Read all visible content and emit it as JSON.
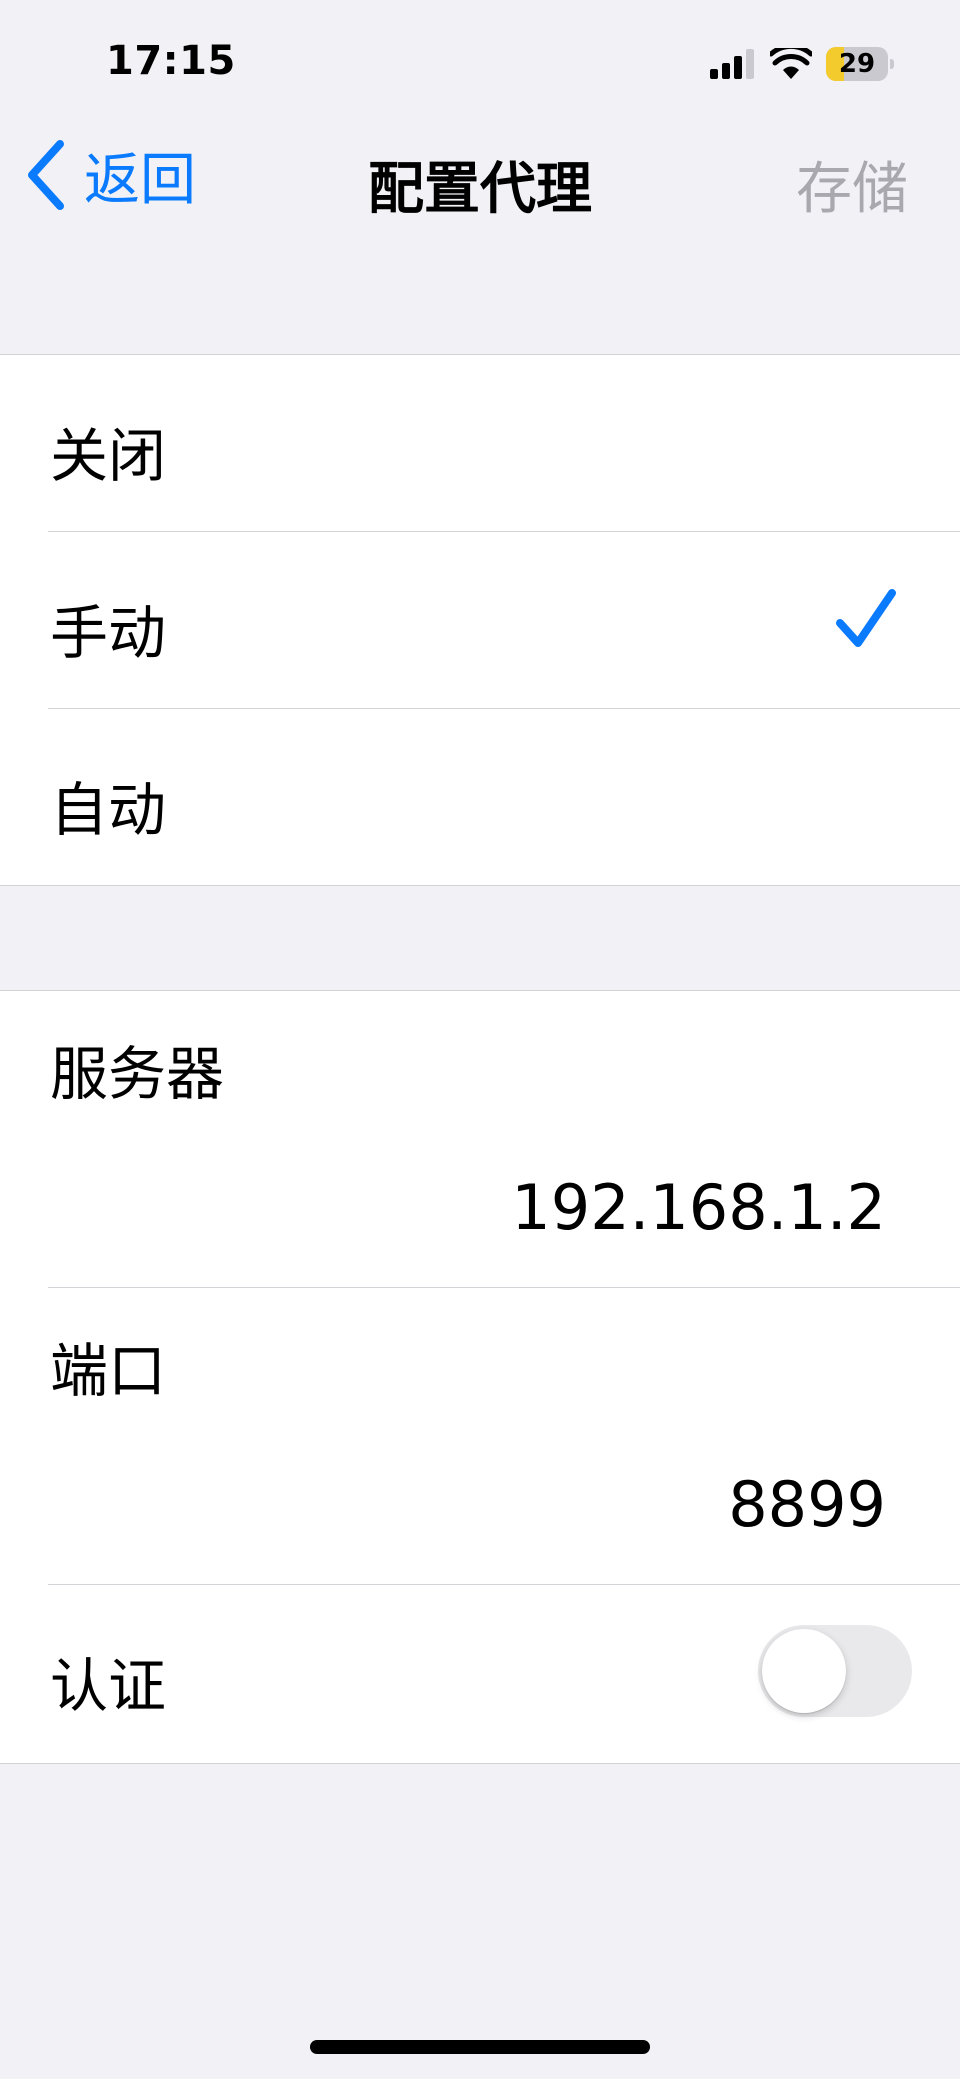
{
  "status_bar": {
    "time": "17:15",
    "battery_level": "29",
    "battery_fraction": 0.29,
    "battery_color": "#f3cb2c"
  },
  "nav": {
    "back_label": "返回",
    "title": "配置代理",
    "save_label": "存储"
  },
  "proxy_modes": {
    "items": [
      {
        "label": "关闭",
        "selected": false
      },
      {
        "label": "手动",
        "selected": true
      },
      {
        "label": "自动",
        "selected": false
      }
    ]
  },
  "settings": {
    "server": {
      "label": "服务器",
      "value": "192.168.1.2"
    },
    "port": {
      "label": "端口",
      "value": "8899"
    },
    "auth": {
      "label": "认证",
      "enabled": false
    }
  },
  "colors": {
    "accent": "#0a7aff",
    "background": "#f1f1f6",
    "disabled_text": "#a8a8ae"
  }
}
